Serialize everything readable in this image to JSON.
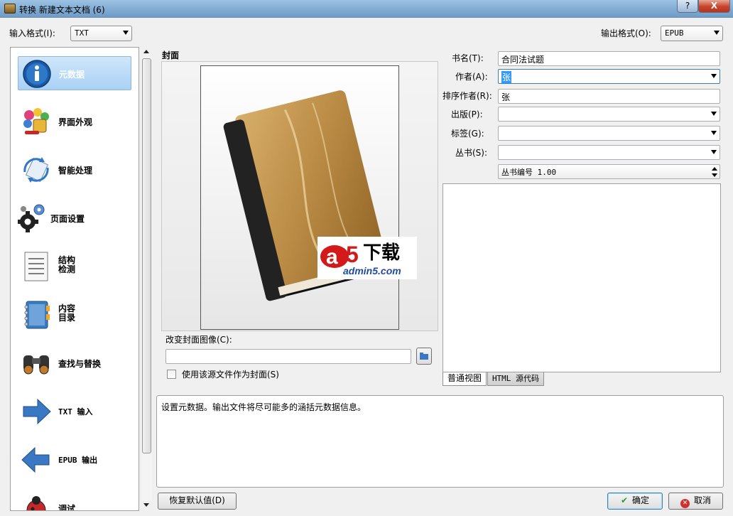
{
  "window": {
    "title": "转换 新建文本文档 (6)",
    "help_label": "?",
    "close_label": "X"
  },
  "input_format": {
    "label": "输入格式(I):",
    "value": "TXT"
  },
  "output_format": {
    "label": "输出格式(O):",
    "value": "EPUB"
  },
  "sidebar": {
    "items": [
      {
        "label": "元数据",
        "icon": "info-icon"
      },
      {
        "label": "界面外观",
        "icon": "paint-icon"
      },
      {
        "label": "智能处理",
        "icon": "refresh-icon"
      },
      {
        "label": "页面设置",
        "icon": "gear-icon"
      },
      {
        "label_line1": "结构",
        "label_line2": "检测",
        "icon": "document-icon"
      },
      {
        "label_line1": "内容",
        "label_line2": "目录",
        "icon": "notebook-icon"
      },
      {
        "label": "查找与替换",
        "icon": "binoculars-icon"
      },
      {
        "label": "TXT 输入",
        "icon": "arrow-right-icon"
      },
      {
        "label": "EPUB 输出",
        "icon": "arrow-left-icon"
      },
      {
        "label": "调试",
        "icon": "bug-icon"
      }
    ]
  },
  "cover": {
    "heading": "封面",
    "change_label": "改变封面图像(C):",
    "path_value": "",
    "use_source_label": "使用该源文件作为封面(S)",
    "watermark_brand": "下载",
    "watermark_url": "admin5.com"
  },
  "metadata": {
    "title_label": "书名(T):",
    "title_value": "合同法试题",
    "author_label": "作者(A):",
    "author_value": "张",
    "author_sort_label": "排序作者(R):",
    "author_sort_value": "张",
    "publisher_label": "出版(P):",
    "publisher_value": "",
    "tags_label": "标签(G):",
    "tags_value": "",
    "series_label": "丛书(S):",
    "series_value": "",
    "series_index": "丛书编号 1.00"
  },
  "comments": {
    "tabs": [
      {
        "label": "普通视图"
      },
      {
        "label": "HTML 源代码"
      }
    ]
  },
  "description": "设置元数据。输出文件将尽可能多的涵括元数据信息。",
  "buttons": {
    "restore_defaults": "恢复默认值(D)",
    "ok": "确定",
    "cancel": "取消"
  },
  "colors": {
    "accent": "#3c7fb1",
    "selection": "#a9d1f5",
    "close_red": "#c7432a"
  }
}
